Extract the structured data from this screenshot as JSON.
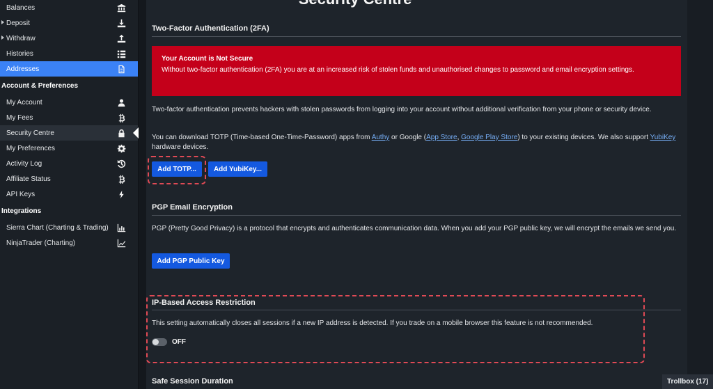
{
  "sidebar": {
    "wallet_items": [
      {
        "label": "Balances",
        "icon": "bank-icon",
        "caret": false
      },
      {
        "label": "Deposit",
        "icon": "download-icon",
        "caret": true
      },
      {
        "label": "Withdraw",
        "icon": "upload-icon",
        "caret": true
      },
      {
        "label": "Histories",
        "icon": "list-icon",
        "caret": false
      },
      {
        "label": "Addresses",
        "icon": "document-icon",
        "caret": false,
        "active": true
      }
    ],
    "account_section": "Account & Preferences",
    "account_items": [
      {
        "label": "My Account",
        "icon": "user-icon"
      },
      {
        "label": "My Fees",
        "icon": "bitcoin-icon"
      },
      {
        "label": "Security Centre",
        "icon": "lock-icon",
        "current": true
      },
      {
        "label": "My Preferences",
        "icon": "gear-icon"
      },
      {
        "label": "Activity Log",
        "icon": "history-icon"
      },
      {
        "label": "Affiliate Status",
        "icon": "bitcoin-icon"
      },
      {
        "label": "API Keys",
        "icon": "bolt-icon"
      }
    ],
    "integrations_section": "Integrations",
    "integration_items": [
      {
        "label": "Sierra Chart (Charting & Trading)",
        "icon": "bar-chart-icon"
      },
      {
        "label": "NinjaTrader (Charting)",
        "icon": "line-chart-icon"
      }
    ]
  },
  "page": {
    "title": "Security Centre"
  },
  "twofa": {
    "title": "Two-Factor Authentication (2FA)",
    "alert_title": "Your Account is Not Secure",
    "alert_body": "Without two-factor authentication (2FA) you are at an increased risk of stolen funds and unauthorised changes to password and email encryption settings.",
    "para1": "Two-factor authentication prevents hackers with stolen passwords from logging into your account without additional verification from your phone or security device.",
    "para2_a": "You can download TOTP (Time-based One-Time-Password) apps from ",
    "link_authy": "Authy",
    "para2_b": " or Google (",
    "link_appstore": "App Store",
    "para2_c": ", ",
    "link_playstore": "Google Play Store",
    "para2_d": ") to your existing devices. We also support ",
    "link_yubikey": "YubiKey",
    "para2_e": " hardware devices.",
    "btn_totp": "Add TOTP...",
    "btn_yubikey": "Add YubiKey..."
  },
  "pgp": {
    "title": "PGP Email Encryption",
    "body": "PGP (Pretty Good Privacy) is a protocol that encrypts and authenticates communication data. When you add your PGP public key, we will encrypt the emails we send you.",
    "btn": "Add PGP Public Key"
  },
  "ip": {
    "title": "IP-Based Access Restriction",
    "body": "This setting automatically closes all sessions if a new IP address is detected. If you trade on a mobile browser this feature is not recommended.",
    "toggle_label": "OFF",
    "enabled": false
  },
  "session": {
    "title": "Safe Session Duration"
  },
  "trollbox": {
    "label": "Trollbox (17)"
  },
  "colors": {
    "accent": "#3b82f6",
    "button": "#1459e0",
    "alert": "#c4001a",
    "highlight": "#e04a55"
  }
}
